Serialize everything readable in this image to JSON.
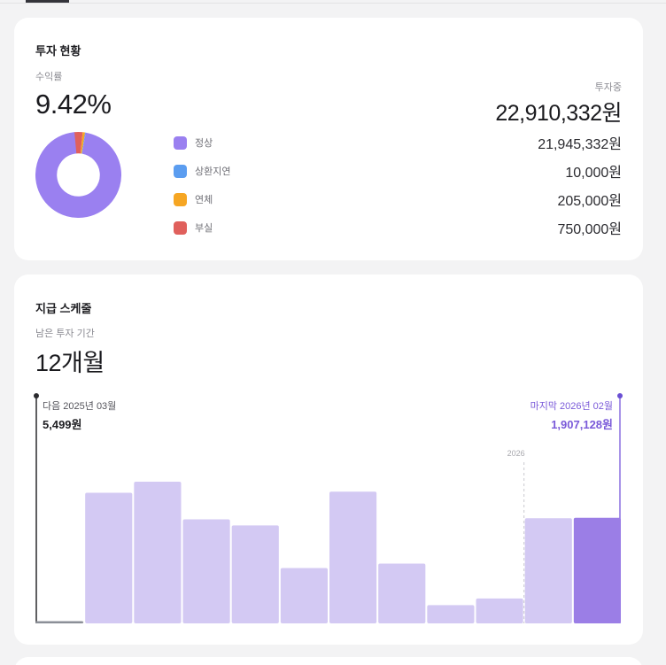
{
  "colors": {
    "normal": "#9a80f0",
    "delayed": "#5b9df0",
    "overdue": "#f6a623",
    "default": "#e0605c",
    "bar": "#d3c9f3",
    "bar_last": "#9b7ee6",
    "bar_current": "#8b8f97"
  },
  "invest": {
    "title": "투자 현황",
    "yield_label": "수익률",
    "yield_value": "9.42%",
    "total_label": "투자중",
    "total_value": "22,910,332원",
    "legend": [
      {
        "label": "정상",
        "value": "21,945,332원",
        "amount": 21945332,
        "color": "#9a80f0"
      },
      {
        "label": "상환지연",
        "value": "10,000원",
        "amount": 10000,
        "color": "#5b9df0"
      },
      {
        "label": "연체",
        "value": "205,000원",
        "amount": 205000,
        "color": "#f6a623"
      },
      {
        "label": "부실",
        "value": "750,000원",
        "amount": 750000,
        "color": "#e0605c"
      }
    ]
  },
  "schedule": {
    "title": "지급 스케줄",
    "remaining_label": "남은 투자 기간",
    "remaining_value": "12개월",
    "next_label": "다음 2025년 03월",
    "next_amount": "5,499원",
    "last_label": "마지막 2026년 02월",
    "last_amount": "1,907,128원",
    "year_marker": "2026"
  },
  "chart_data": {
    "type": "bar",
    "categories": [
      "2025-03",
      "2025-04",
      "2025-05",
      "2025-06",
      "2025-07",
      "2025-08",
      "2025-09",
      "2025-10",
      "2025-11",
      "2025-12",
      "2026-01",
      "2026-02"
    ],
    "values": [
      5499,
      2360000,
      2560000,
      1880000,
      1770000,
      1000000,
      2380000,
      1080000,
      330000,
      450000,
      1900000,
      1907128
    ],
    "title": "",
    "xlabel": "",
    "ylabel": "",
    "ylim": [
      0,
      2560000
    ]
  }
}
